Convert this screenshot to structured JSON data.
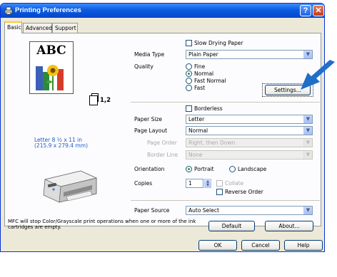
{
  "window": {
    "title": "Printing Preferences",
    "help": "?",
    "close": "✕"
  },
  "tabs": [
    {
      "label": "Basic"
    },
    {
      "label": "Advanced"
    },
    {
      "label": "Support"
    }
  ],
  "preview": {
    "sample_text": "ABC",
    "copies_badge": "1,2",
    "paper_line1": "Letter 8 ½ x 11 in",
    "paper_line2": "(215.9 x 279.4 mm)"
  },
  "slow_drying": {
    "label": "Slow Drying Paper",
    "checked": false
  },
  "media_type": {
    "label": "Media Type",
    "value": "Plain Paper"
  },
  "quality": {
    "label": "Quality",
    "options": [
      "Fine",
      "Normal",
      "Fast Normal",
      "Fast"
    ],
    "selected": "Normal"
  },
  "settings_button": "Settings...",
  "borderless": {
    "label": "Borderless",
    "checked": false
  },
  "paper_size": {
    "label": "Paper Size",
    "value": "Letter"
  },
  "page_layout": {
    "label": "Page Layout",
    "value": "Normal"
  },
  "page_order": {
    "label": "Page Order",
    "value": "Right, then Down",
    "disabled": true
  },
  "border_line": {
    "label": "Border Line",
    "value": "None",
    "disabled": true
  },
  "orientation": {
    "label": "Orientation",
    "portrait": "Portrait",
    "landscape": "Landscape",
    "selected": "Portrait"
  },
  "copies": {
    "label": "Copies",
    "value": "1",
    "collate": "Collate",
    "reverse_order": "Reverse Order"
  },
  "paper_source": {
    "label": "Paper Source",
    "value": "Auto Select"
  },
  "note": {
    "line1": "MFC will stop Color/Grayscale print operations when one or more of the ink",
    "line2": "cartridges are empty."
  },
  "buttons": {
    "default": "Default",
    "about": "About...",
    "ok": "OK",
    "cancel": "Cancel",
    "help": "Help"
  },
  "colors": {
    "titlebar": "#0a5ce0",
    "dialog": "#ece9d8",
    "arrow": "#1f6fc8",
    "info_text": "#1d5bc9"
  }
}
